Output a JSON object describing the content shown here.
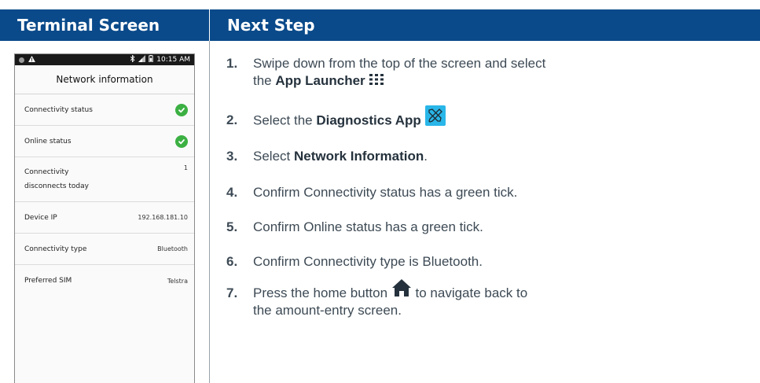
{
  "header": {
    "left_title": "Terminal Screen",
    "right_title": "Next Step"
  },
  "terminal": {
    "status_bar": {
      "left_icons": [
        "circle-icon",
        "warning-icon"
      ],
      "right_icons": [
        "bluetooth-icon",
        "signal-icon",
        "battery-icon"
      ],
      "time": "10:15 AM"
    },
    "title": "Network information",
    "rows": [
      {
        "label": "Connectivity status",
        "value_icon": "green-tick-icon"
      },
      {
        "label": "Online status",
        "value_icon": "green-tick-icon"
      },
      {
        "label_line1": "Connectivity",
        "label_line2": "disconnects today",
        "value": "1"
      },
      {
        "label": "Device IP",
        "value": "192.168.181.10"
      },
      {
        "label": "Connectivity type",
        "value": "Bluetooth"
      },
      {
        "label": "Preferred SIM",
        "value": "Telstra"
      }
    ]
  },
  "steps": [
    {
      "num": "1.",
      "pre": "Swipe down from the top of the screen and select",
      "line2_pre": "the ",
      "bold": "App Launcher",
      "icon": "grid-icon"
    },
    {
      "num": "2.",
      "pre": "Select the ",
      "bold": "Diagnostics App",
      "icon": "tools-icon"
    },
    {
      "num": "3.",
      "pre": "Select ",
      "bold": "Network Information",
      "post": "."
    },
    {
      "num": "4.",
      "text": "Confirm Connectivity status has a green tick."
    },
    {
      "num": "5.",
      "text": "Confirm Online status has a green tick."
    },
    {
      "num": "6.",
      "text": "Confirm Connectivity type is Bluetooth."
    },
    {
      "num": "7.",
      "pre": "Press the home button",
      "post": " to navigate back to",
      "line2": "the amount-entry screen.",
      "icon": "home-icon"
    }
  ],
  "colors": {
    "header_bg": "#0a4a8a",
    "tick_green": "#3cb043",
    "tools_icon_bg": "#29b6e8",
    "text": "#3d4a55"
  }
}
